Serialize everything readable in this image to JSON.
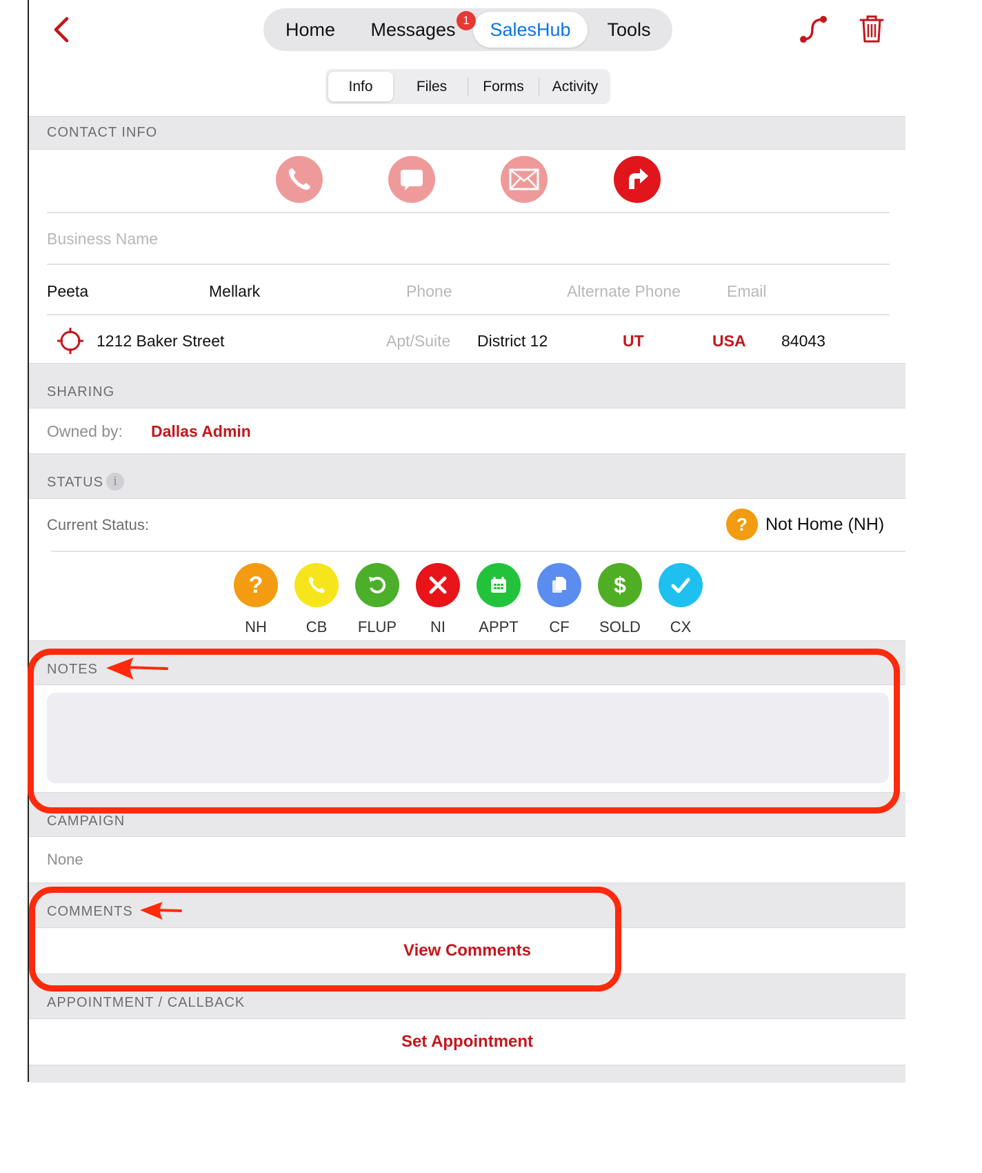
{
  "topbar": {
    "tabs": [
      {
        "label": "Home"
      },
      {
        "label": "Messages"
      },
      {
        "label": "SalesHub"
      },
      {
        "label": "Tools"
      }
    ],
    "messages_badge": "1",
    "active_tab": "SalesHub"
  },
  "subtabs": [
    {
      "label": "Info"
    },
    {
      "label": "Files"
    },
    {
      "label": "Forms"
    },
    {
      "label": "Activity"
    }
  ],
  "contact_info": {
    "header": "CONTACT INFO",
    "actions": [
      "phone-icon",
      "message-icon",
      "mail-icon",
      "directions-icon"
    ],
    "business_name_placeholder": "Business Name",
    "first_name": "Peeta",
    "last_name": "Mellark",
    "phone_placeholder": "Phone",
    "alt_phone_placeholder": "Alternate Phone",
    "email_placeholder": "Email",
    "street": "1212 Baker Street",
    "apt_placeholder": "Apt/Suite",
    "city": "District 12",
    "state": "UT",
    "country": "USA",
    "zip": "84043"
  },
  "sharing": {
    "header": "SHARING",
    "owned_by_label": "Owned by:",
    "owner": "Dallas Admin"
  },
  "status": {
    "header": "STATUS",
    "info_glyph": "i",
    "current_label": "Current Status:",
    "current_value": "Not Home (NH)",
    "current_glyph": "?",
    "options": [
      {
        "label": "NH",
        "color": "#f39c12",
        "icon": "question-icon"
      },
      {
        "label": "CB",
        "color": "#f6e51a",
        "icon": "phone-icon"
      },
      {
        "label": "FLUP",
        "color": "#4caf2a",
        "icon": "refresh-icon"
      },
      {
        "label": "NI",
        "color": "#e8141a",
        "icon": "close-icon"
      },
      {
        "label": "APPT",
        "color": "#22c33a",
        "icon": "calendar-icon"
      },
      {
        "label": "CF",
        "color": "#5b8df0",
        "icon": "copy-icon"
      },
      {
        "label": "SOLD",
        "color": "#4fae23",
        "icon": "dollar-icon"
      },
      {
        "label": "CX",
        "color": "#1ec0ef",
        "icon": "check-icon"
      }
    ],
    "glyphs": {
      "NH": "?",
      "SOLD": "$"
    }
  },
  "notes": {
    "header": "NOTES",
    "value": ""
  },
  "campaign": {
    "header": "CAMPAIGN",
    "value": "None"
  },
  "comments": {
    "header": "COMMENTS",
    "link": "View Comments"
  },
  "appointment": {
    "header": "APPOINTMENT / CALLBACK",
    "link": "Set Appointment"
  },
  "colors": {
    "accent": "#c4161c",
    "active_tab": "#0a73e8",
    "annotation": "#ff2a0c"
  }
}
